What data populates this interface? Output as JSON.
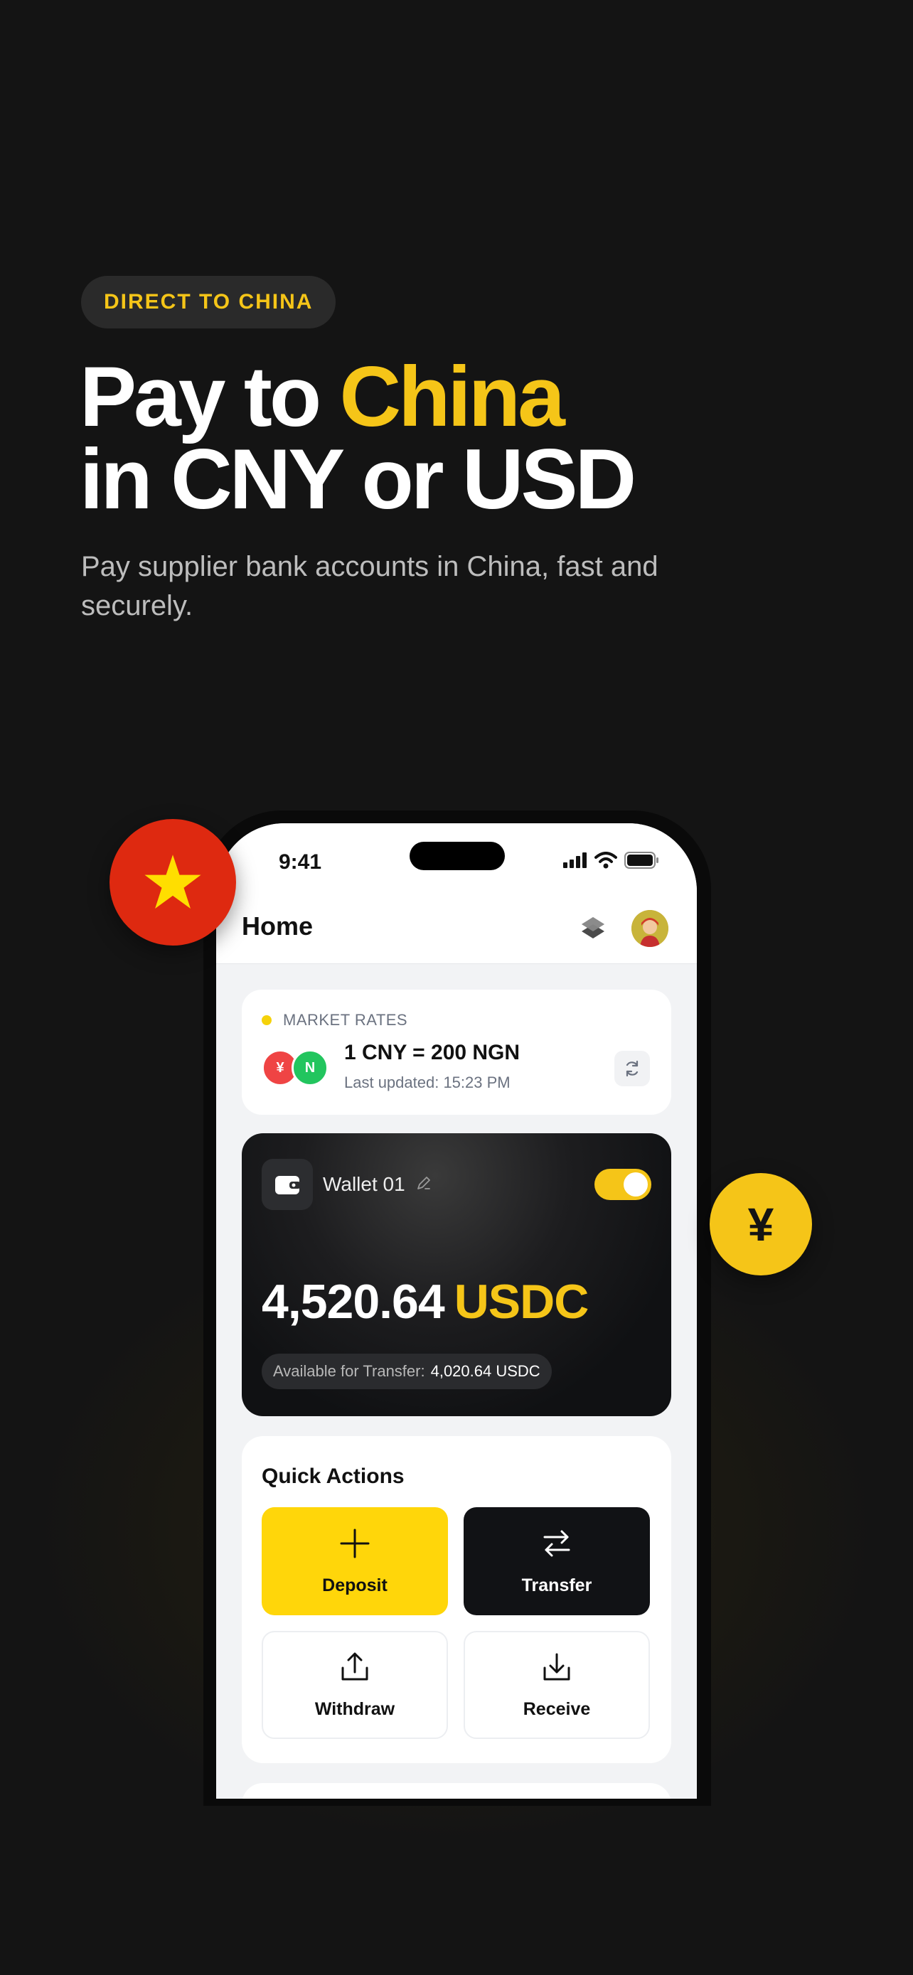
{
  "promo": {
    "badge": "DIRECT TO CHINA",
    "headline_part1": "Pay to ",
    "headline_accent": "China",
    "headline_line2": "in CNY or USD",
    "subtitle": "Pay supplier bank accounts in China, fast and securely."
  },
  "decor": {
    "flag_icon": "china-flag-star-icon",
    "yen_symbol": "¥"
  },
  "status_bar": {
    "time": "9:41"
  },
  "header": {
    "title": "Home"
  },
  "market_rates": {
    "label": "MARKET RATES",
    "from_symbol": "¥",
    "to_symbol": "N",
    "rate": "1 CNY = 200 NGN",
    "updated": "Last updated: 15:23 PM"
  },
  "wallet": {
    "name": "Wallet 01",
    "enabled": true,
    "balance": "4,520.64",
    "currency": "USDC",
    "available_label": "Available for Transfer:",
    "available_value": "4,020.64 USDC"
  },
  "quick_actions": {
    "title": "Quick Actions",
    "deposit": "Deposit",
    "transfer": "Transfer",
    "withdraw": "Withdraw",
    "receive": "Receive"
  },
  "colors": {
    "background": "#141414",
    "accent": "#f5c518",
    "deposit": "#ffd60a",
    "flag_red": "#de2910"
  }
}
